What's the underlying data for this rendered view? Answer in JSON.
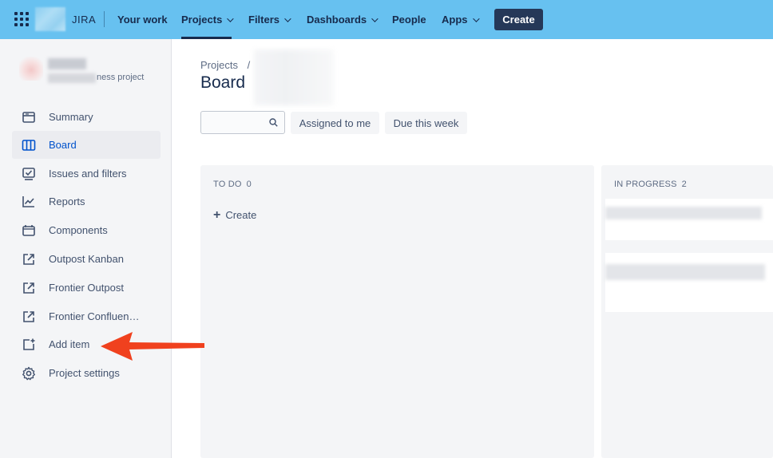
{
  "topnav": {
    "app_name": "JIRA",
    "items": [
      {
        "label": "Your work",
        "dropdown": false,
        "active": false
      },
      {
        "label": "Projects",
        "dropdown": true,
        "active": true
      },
      {
        "label": "Filters",
        "dropdown": true,
        "active": false
      },
      {
        "label": "Dashboards",
        "dropdown": true,
        "active": false
      },
      {
        "label": "People",
        "dropdown": false,
        "active": false
      },
      {
        "label": "Apps",
        "dropdown": true,
        "active": false
      }
    ],
    "create_label": "Create",
    "background_color": "#67c1f0"
  },
  "sidebar": {
    "project_type": "ness project",
    "items": [
      {
        "label": "Summary",
        "icon": "summary-icon",
        "selected": false
      },
      {
        "label": "Board",
        "icon": "board-icon",
        "selected": true
      },
      {
        "label": "Issues and filters",
        "icon": "issues-icon",
        "selected": false
      },
      {
        "label": "Reports",
        "icon": "reports-icon",
        "selected": false
      },
      {
        "label": "Components",
        "icon": "components-icon",
        "selected": false
      },
      {
        "label": "Outpost Kanban",
        "icon": "external-link-icon",
        "selected": false
      },
      {
        "label": "Frontier Outpost",
        "icon": "external-link-icon",
        "selected": false
      },
      {
        "label": "Frontier Confluen…",
        "icon": "external-link-icon",
        "selected": false
      },
      {
        "label": "Add item",
        "icon": "add-item-icon",
        "selected": false
      },
      {
        "label": "Project settings",
        "icon": "gear-icon",
        "selected": false
      }
    ]
  },
  "main": {
    "breadcrumb": "Projects",
    "breadcrumb_separator": "/",
    "title": "Board",
    "search": {
      "value": "",
      "placeholder": ""
    },
    "filters": [
      "Assigned to me",
      "Due this week"
    ],
    "columns": [
      {
        "name": "TO DO",
        "count": "0",
        "create_label": "Create"
      },
      {
        "name": "IN PROGRESS",
        "count": "2"
      }
    ]
  },
  "annotation": {
    "color": "#f0411e"
  }
}
